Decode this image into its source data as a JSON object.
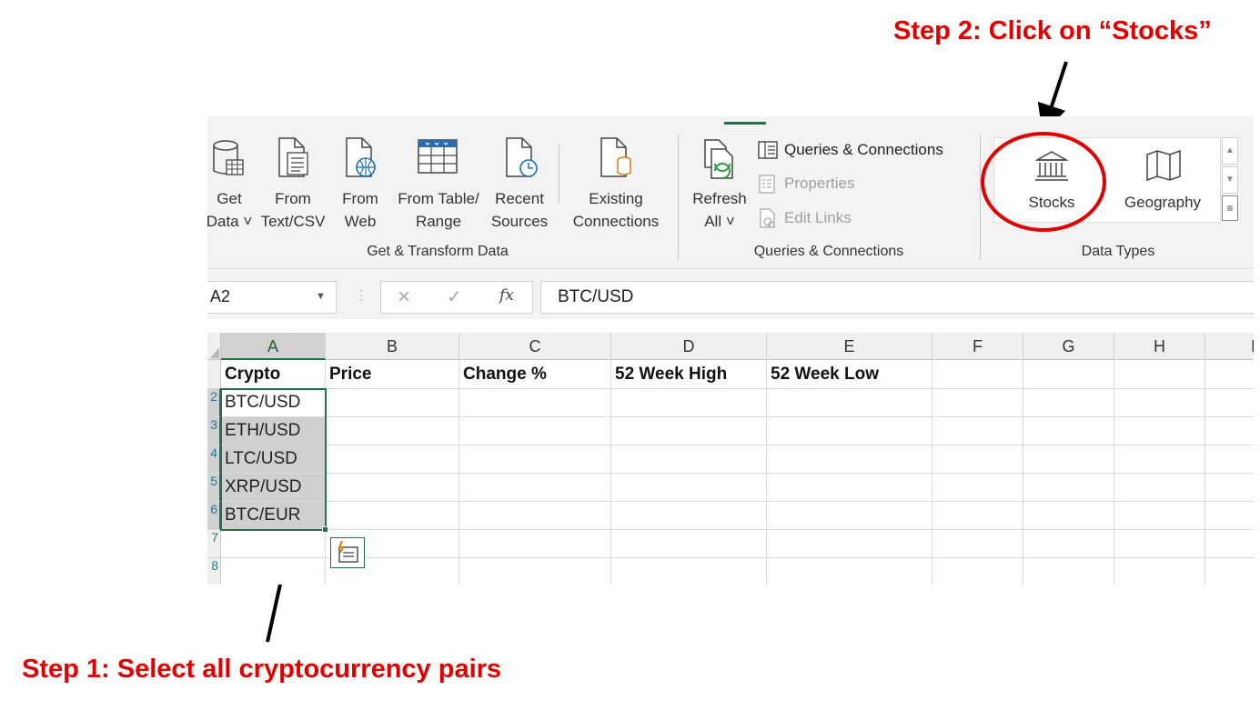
{
  "annotations": {
    "step2": "Step 2: Click on “Stocks”",
    "step1": "Step 1: Select all cryptocurrency pairs"
  },
  "ribbon": {
    "get_transform": {
      "buttons": [
        {
          "line1": "Get",
          "line2": "Data ˅",
          "icon": "database-icon"
        },
        {
          "line1": "From",
          "line2": "Text/CSV",
          "icon": "text-file-icon"
        },
        {
          "line1": "From",
          "line2": "Web",
          "icon": "web-page-icon"
        },
        {
          "line1": "From Table/",
          "line2": "Range",
          "icon": "table-icon"
        },
        {
          "line1": "Recent",
          "line2": "Sources",
          "icon": "recent-file-icon"
        },
        {
          "line1": "Existing",
          "line2": "Connections",
          "icon": "connection-file-icon"
        }
      ],
      "label": "Get & Transform Data"
    },
    "queries": {
      "refresh_line1": "Refresh",
      "refresh_line2": "All ˅",
      "items": [
        "Queries & Connections",
        "Properties",
        "Edit Links"
      ],
      "label": "Queries & Connections"
    },
    "data_types": {
      "stocks": "Stocks",
      "geography": "Geography",
      "label": "Data Types"
    }
  },
  "formula_bar": {
    "name_box": "A2",
    "fx": "fx",
    "value": "BTC/USD"
  },
  "sheet": {
    "columns": [
      "A",
      "B",
      "C",
      "D",
      "E",
      "F",
      "G",
      "H",
      "I"
    ],
    "headers": [
      "Crypto",
      "Price",
      "Change %",
      "52 Week High",
      "52 Week Low"
    ],
    "row_numbers": [
      "",
      "2",
      "3",
      "4",
      "5",
      "6",
      "7",
      "8"
    ],
    "crypto": [
      "BTC/USD",
      "ETH/USD",
      "LTC/USD",
      "XRP/USD",
      "BTC/EUR"
    ]
  },
  "colors": {
    "annotation_red": "#e00000",
    "excel_green": "#217346"
  }
}
